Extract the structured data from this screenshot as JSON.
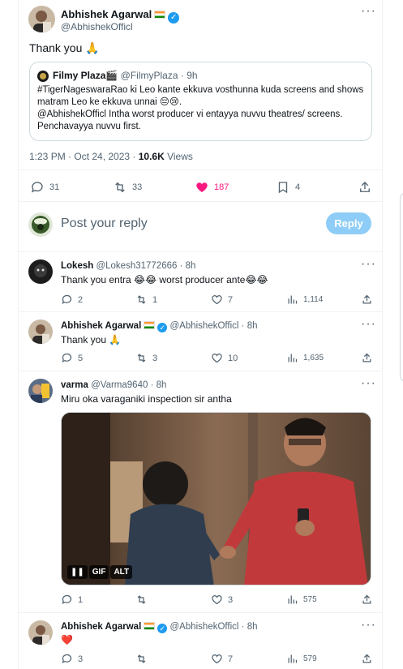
{
  "main_tweet": {
    "author_name": "Abhishek Agarwal",
    "author_handle": "@AbhishekOfficl",
    "text": "Thank you 🙏",
    "timestamp": "1:23 PM · Oct 24, 2023 · ",
    "views_count": "10.6K",
    "views_label": " Views",
    "replies": "31",
    "retweets": "33",
    "likes": "187",
    "bookmarks": "4"
  },
  "quoted_tweet": {
    "author_name": "Filmy Plaza🎬",
    "author_handle": "@FilmyPlaza",
    "time": "· 9h",
    "line1": "#TigerNageswaraRao ki Leo kante ekkuva vosthunna kuda screens and shows",
    "line2": "matram Leo ke ekkuva unnai 😔😢.",
    "line3": "@AbhishekOfficl Intha worst producer vi entayya nuvvu theatres/ screens.",
    "line4": "Penchavayya nuvvu first."
  },
  "composer": {
    "placeholder": "Post your reply",
    "reply_button": "Reply"
  },
  "replies": [
    {
      "name": "Lokesh",
      "handle": "@Lokesh31772666",
      "time": "· 8h",
      "text": "Thank you entra 😂😂 worst producer ante😂😂",
      "replies": "2",
      "retweets": "1",
      "likes": "7",
      "views": "1,114"
    },
    {
      "name": "Abhishek Agarwal",
      "handle": "@AbhishekOfficl",
      "time": "· 8h",
      "text": "Thank you 🙏",
      "replies": "5",
      "retweets": "3",
      "likes": "10",
      "views": "1,635"
    },
    {
      "name": "varma",
      "handle": "@Varma9640",
      "time": "· 8h",
      "text": "Miru oka varaganiki inspection sir antha",
      "replies": "1",
      "retweets": "",
      "likes": "3",
      "views": "575",
      "media_badges": [
        "GIF",
        "ALT"
      ]
    },
    {
      "name": "Abhishek Agarwal",
      "handle": "@AbhishekOfficl",
      "time": "· 8h",
      "text": "❤️",
      "replies": "3",
      "retweets": "",
      "likes": "7",
      "views": "579"
    }
  ],
  "colors": {
    "like_active": "#f91880",
    "accent": "#1d9bf0",
    "reply_button_disabled": "#8ecdf7"
  }
}
